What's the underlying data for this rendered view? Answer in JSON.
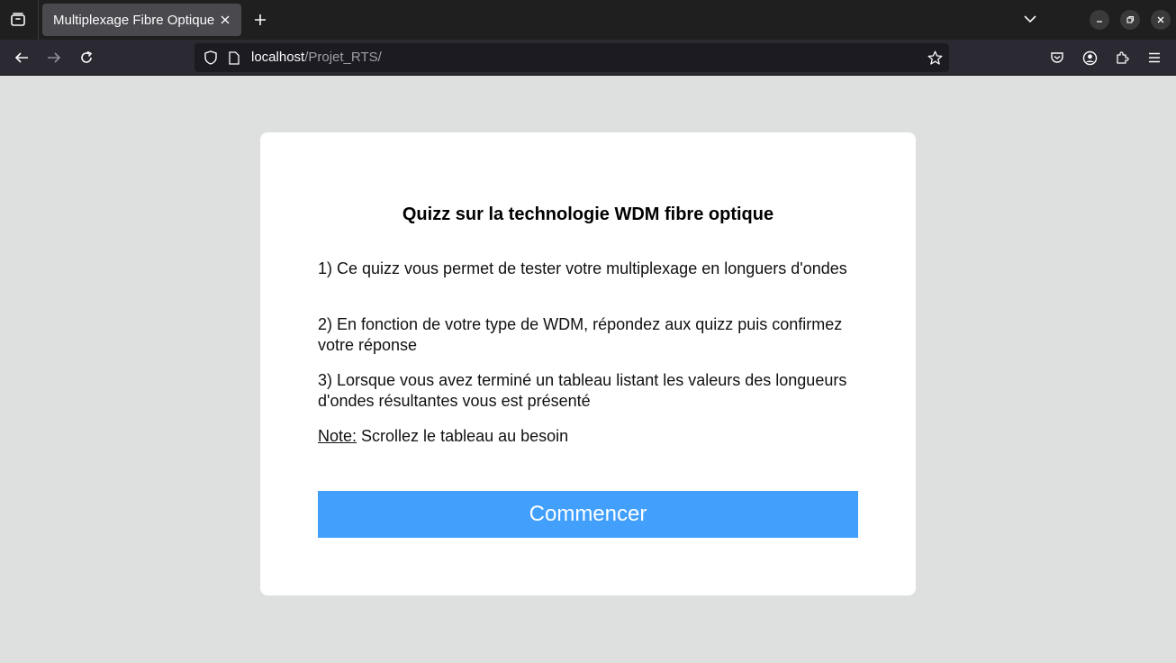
{
  "browser": {
    "tab_title": "Multiplexage Fibre Optique",
    "url_host": "localhost",
    "url_path": "/Projet_RTS/",
    "icons": [
      "tabs-overview-icon",
      "close-icon",
      "plus-icon",
      "chevron-down-icon",
      "minimize-icon",
      "restore-icon",
      "close-icon",
      "back-arrow-icon",
      "forward-arrow-icon",
      "reload-icon",
      "shield-icon",
      "page-icon",
      "star-icon",
      "pocket-icon",
      "account-icon",
      "extensions-icon",
      "menu-icon"
    ]
  },
  "page": {
    "title": "Quizz sur la technologie WDM fibre optique",
    "items": [
      "1) Ce quizz vous permet de tester votre multiplexage en longuers d'ondes",
      "2) En fonction de votre type de WDM, répondez aux quizz puis confirmez votre réponse",
      "3) Lorsque vous avez terminé un tableau listant les valeurs des longueurs d'ondes résultantes vous est présenté"
    ],
    "note_label": "Note:",
    "note_text": " Scrollez le tableau au besoin",
    "start_button": "Commencer"
  },
  "colors": {
    "page_background": "#dedfdf",
    "card_background": "#ffffff",
    "button_background": "#42a0fc",
    "button_text": "#ffffff"
  }
}
